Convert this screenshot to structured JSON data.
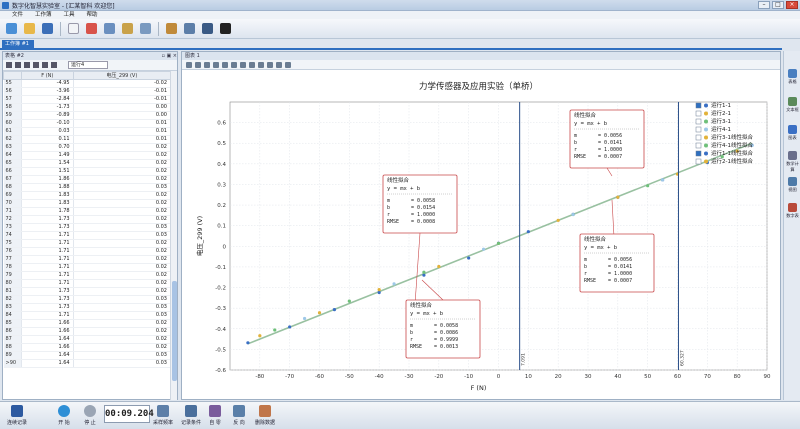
{
  "window": {
    "title": "数字化智慧实验室  - [汇某智科 欢迎您]"
  },
  "menu": [
    "文件",
    "工作簿",
    "工具",
    "帮助"
  ],
  "tabs": {
    "doc": "工作簿 #1",
    "table_panel": "表格 #2",
    "chart_panel": "图表 1"
  },
  "table": {
    "run_selector": "运行4",
    "col_f": "F (N)",
    "col_v": "电压_299 (V)",
    "rows": [
      [
        "55",
        "-4.95",
        "-0.02"
      ],
      [
        "56",
        "-3.96",
        "-0.01"
      ],
      [
        "57",
        "-2.84",
        "-0.01"
      ],
      [
        "58",
        "-1.73",
        "0.00"
      ],
      [
        "59",
        "-0.89",
        "0.00"
      ],
      [
        "60",
        "-0.10",
        "0.01"
      ],
      [
        "61",
        "0.03",
        "0.01"
      ],
      [
        "62",
        "0.11",
        "0.01"
      ],
      [
        "63",
        "0.70",
        "0.02"
      ],
      [
        "64",
        "1.49",
        "0.02"
      ],
      [
        "65",
        "1.54",
        "0.02"
      ],
      [
        "66",
        "1.51",
        "0.02"
      ],
      [
        "67",
        "1.86",
        "0.02"
      ],
      [
        "68",
        "1.88",
        "0.03"
      ],
      [
        "69",
        "1.83",
        "0.02"
      ],
      [
        "70",
        "1.83",
        "0.02"
      ],
      [
        "71",
        "1.78",
        "0.02"
      ],
      [
        "72",
        "1.73",
        "0.02"
      ],
      [
        "73",
        "1.73",
        "0.03"
      ],
      [
        "74",
        "1.71",
        "0.03"
      ],
      [
        "75",
        "1.71",
        "0.02"
      ],
      [
        "76",
        "1.71",
        "0.02"
      ],
      [
        "77",
        "1.71",
        "0.02"
      ],
      [
        "78",
        "1.71",
        "0.02"
      ],
      [
        "79",
        "1.71",
        "0.02"
      ],
      [
        "80",
        "1.71",
        "0.02"
      ],
      [
        "81",
        "1.73",
        "0.02"
      ],
      [
        "82",
        "1.73",
        "0.03"
      ],
      [
        "83",
        "1.73",
        "0.03"
      ],
      [
        "84",
        "1.71",
        "0.03"
      ],
      [
        "85",
        "1.66",
        "0.02"
      ],
      [
        "86",
        "1.66",
        "0.02"
      ],
      [
        "87",
        "1.64",
        "0.02"
      ],
      [
        "88",
        "1.66",
        "0.02"
      ],
      [
        "89",
        "1.64",
        "0.03"
      ],
      [
        ">90",
        "1.64",
        "0.03"
      ]
    ]
  },
  "chart_data": {
    "type": "scatter",
    "title": "力学传感器及应用实验（单桥）",
    "xlabel": "F (N)",
    "ylabel": "电压_299 (V)",
    "xlim": [
      -90,
      90
    ],
    "ylim": [
      -0.6,
      0.7
    ],
    "xticks": [
      -80,
      -70,
      -60,
      -50,
      -40,
      -30,
      -20,
      -10,
      0,
      10,
      20,
      30,
      40,
      50,
      60,
      70,
      80,
      90
    ],
    "yticks": [
      -0.6,
      -0.5,
      -0.4,
      -0.3,
      -0.2,
      -0.1,
      0,
      0.1,
      0.2,
      0.3,
      0.4,
      0.5,
      0.6
    ],
    "grid": true,
    "legend_position": "top-right",
    "series": [
      {
        "name": "运行1-1",
        "color": "#3a6fc4",
        "x": [
          -84,
          -70,
          -55,
          -40,
          -25,
          -10,
          0,
          10,
          25,
          40,
          55,
          70,
          85
        ],
        "y": [
          -0.468,
          -0.391,
          -0.307,
          -0.224,
          -0.14,
          -0.057,
          0.015,
          0.071,
          0.155,
          0.238,
          0.322,
          0.406,
          0.49
        ]
      },
      {
        "name": "运行2-1",
        "color": "#e2b23a",
        "x": [
          -80,
          -60,
          -40,
          -20,
          0,
          20,
          40,
          60,
          80
        ],
        "y": [
          -0.434,
          -0.322,
          -0.21,
          -0.098,
          0.014,
          0.126,
          0.238,
          0.35,
          0.462
        ]
      },
      {
        "name": "运行3-1",
        "color": "#6fc07a",
        "x": [
          -75,
          -50,
          -25,
          0,
          25,
          50,
          75
        ],
        "y": [
          -0.406,
          -0.266,
          -0.126,
          0.014,
          0.154,
          0.294,
          0.434
        ]
      },
      {
        "name": "运行4-1",
        "color": "#9ec8e8",
        "x": [
          -65,
          -35,
          -5,
          25,
          55,
          85
        ],
        "y": [
          -0.35,
          -0.182,
          -0.014,
          0.154,
          0.322,
          0.49
        ]
      }
    ],
    "markers": [
      {
        "x": 7.091,
        "label": "7.091"
      },
      {
        "x": 60.327,
        "label": "60.327"
      }
    ],
    "legend": [
      "运行1-1",
      "运行2-1",
      "运行3-1",
      "运行4-1",
      "运行3-1线性拟合",
      "运行4-1线性拟合",
      "运行1-1线性拟合",
      "运行2-1线性拟合"
    ],
    "fits": [
      {
        "title": "线性拟合",
        "eq": "y = mx + b",
        "m": "0.0058",
        "b": "0.0154",
        "r": "1.0000",
        "rmse": "0.0008"
      },
      {
        "title": "线性拟合",
        "eq": "y = mx + b",
        "m": "0.0056",
        "b": "0.0141",
        "r": "1.0000",
        "rmse": "0.0007"
      },
      {
        "title": "线性拟合",
        "eq": "y = mx + b",
        "m": "0.0056",
        "b": "0.0141",
        "r": "1.0000",
        "rmse": "0.0007"
      },
      {
        "title": "线性拟合",
        "eq": "y = mx + b",
        "m": "0.0058",
        "b": "0.0086",
        "r": "0.9999",
        "rmse": "0.0013"
      }
    ]
  },
  "status": {
    "timer": "00:09.204",
    "buttons": [
      "连续记录",
      "开 始",
      "停 止",
      "采样频率",
      "记录条件",
      "自 零",
      "反 向",
      "删除数据"
    ]
  },
  "sidebar": [
    "表格",
    "文本框",
    "图表",
    "数学计算",
    "视图",
    "数字表"
  ]
}
